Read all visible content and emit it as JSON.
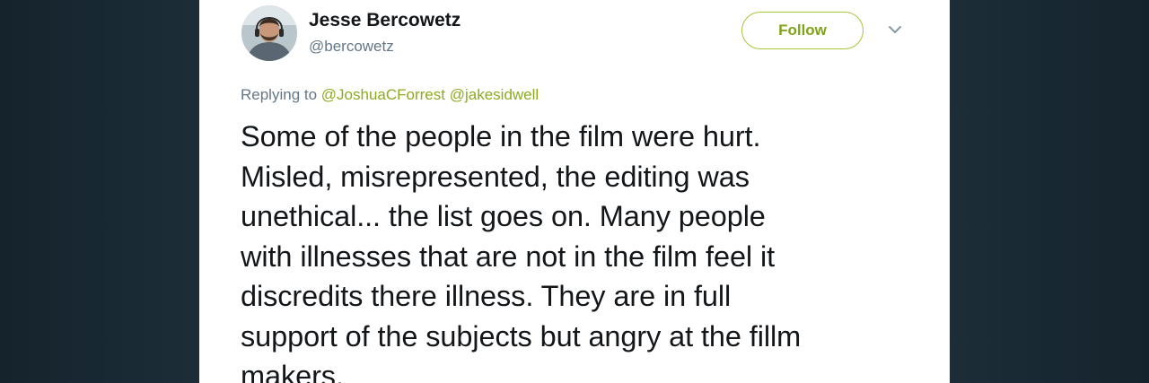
{
  "tweet": {
    "author_name": "Jesse Bercowetz",
    "author_handle": "@bercowetz",
    "follow_label": "Follow",
    "menu_icon": "chevron-down-icon",
    "avatar_icon": "avatar",
    "replying_to_label": "Replying to",
    "mentions": [
      "@JoshuaCForrest",
      "@jakesidwell"
    ],
    "text_lines": [
      "Some of the people in the film were hurt.",
      "Misled, misrepresented, the editing was",
      "unethical... the list goes on. Many people",
      "with illnesses that are not in the film feel it",
      "discredits there illness. They are in full",
      "support of the subjects but angry at the fillm",
      "makers."
    ]
  },
  "colors": {
    "background": "#1d2f3a",
    "card": "#ffffff",
    "accent": "#8cab1f",
    "text": "#14171a",
    "muted": "#657786"
  }
}
